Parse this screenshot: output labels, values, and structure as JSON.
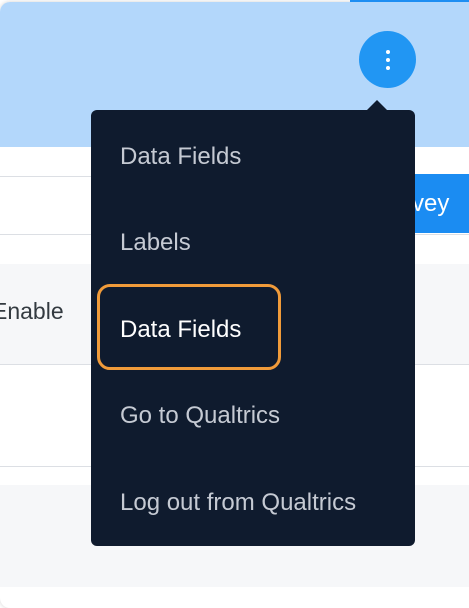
{
  "header": {
    "more_options_icon": "vertical-ellipsis"
  },
  "background": {
    "tab_label_partial": "vey",
    "column_label_partial": "Enable"
  },
  "dropdown_menu": {
    "items": [
      {
        "label": "Data Fields"
      },
      {
        "label": "Labels"
      },
      {
        "label": "Data Fields",
        "highlighted": true
      },
      {
        "label": "Go to Qualtrics"
      },
      {
        "label": "Log out from Qualtrics"
      }
    ]
  },
  "colors": {
    "header_background": "#b3d7fb",
    "accent_blue": "#2196f3",
    "menu_background": "#0f1b2e",
    "highlight_outline": "#f09b3a"
  }
}
